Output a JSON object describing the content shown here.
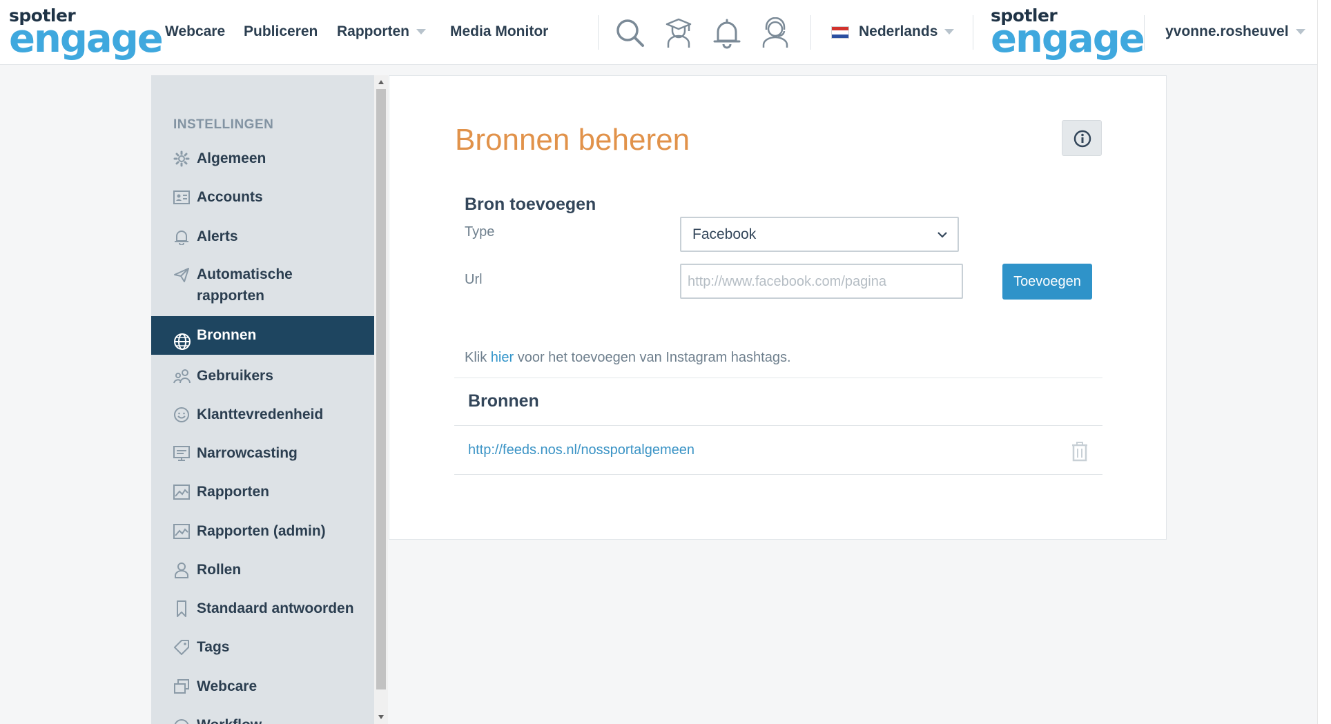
{
  "brand": {
    "small": "spotler",
    "big": "engage",
    "accent": "#3fa8de"
  },
  "nav": {
    "items": [
      {
        "label": "Webcare"
      },
      {
        "label": "Publiceren"
      },
      {
        "label": "Rapporten"
      },
      {
        "label": "Media Monitor"
      }
    ],
    "icons": [
      "search-icon",
      "academy-icon",
      "bell-icon",
      "support-icon"
    ],
    "language": "Nederlands",
    "user": "yvonne.rosheuvel"
  },
  "sidebar": {
    "heading": "INSTELLINGEN",
    "items": [
      {
        "label": "Algemeen",
        "icon": "gear-icon"
      },
      {
        "label": "Accounts",
        "icon": "id-card-icon"
      },
      {
        "label": "Alerts",
        "icon": "bell-icon"
      },
      {
        "label": "Automatische rapporten",
        "icon": "paper-plane-icon"
      },
      {
        "label": "Bronnen",
        "icon": "globe-icon",
        "active": true
      },
      {
        "label": "Gebruikers",
        "icon": "users-icon"
      },
      {
        "label": "Klanttevredenheid",
        "icon": "smiley-icon"
      },
      {
        "label": "Narrowcasting",
        "icon": "monitor-icon"
      },
      {
        "label": "Rapporten",
        "icon": "chart-image-icon"
      },
      {
        "label": "Rapporten (admin)",
        "icon": "chart-image-icon"
      },
      {
        "label": "Rollen",
        "icon": "user-icon"
      },
      {
        "label": "Standaard antwoorden",
        "icon": "bookmark-icon"
      },
      {
        "label": "Tags",
        "icon": "tag-icon"
      },
      {
        "label": "Webcare",
        "icon": "windows-icon"
      },
      {
        "label": "Workflow",
        "icon": "workflow-icon"
      }
    ]
  },
  "main": {
    "title": "Bronnen beheren",
    "add_section": {
      "title": "Bron toevoegen",
      "type_label": "Type",
      "type_value": "Facebook",
      "url_label": "Url",
      "url_placeholder": "http://www.facebook.com/pagina",
      "add_button": "Toevoegen"
    },
    "hint": {
      "before": "Klik ",
      "link": "hier",
      "after": " voor het toevoegen van Instagram hashtags."
    },
    "sources_section": {
      "title": "Bronnen",
      "items": [
        {
          "url": "http://feeds.nos.nl/nossportalgemeen"
        }
      ]
    }
  },
  "colors": {
    "title_orange": "#e1924a",
    "active_sidebar": "#1e4560",
    "button_blue": "#2f93c9"
  }
}
